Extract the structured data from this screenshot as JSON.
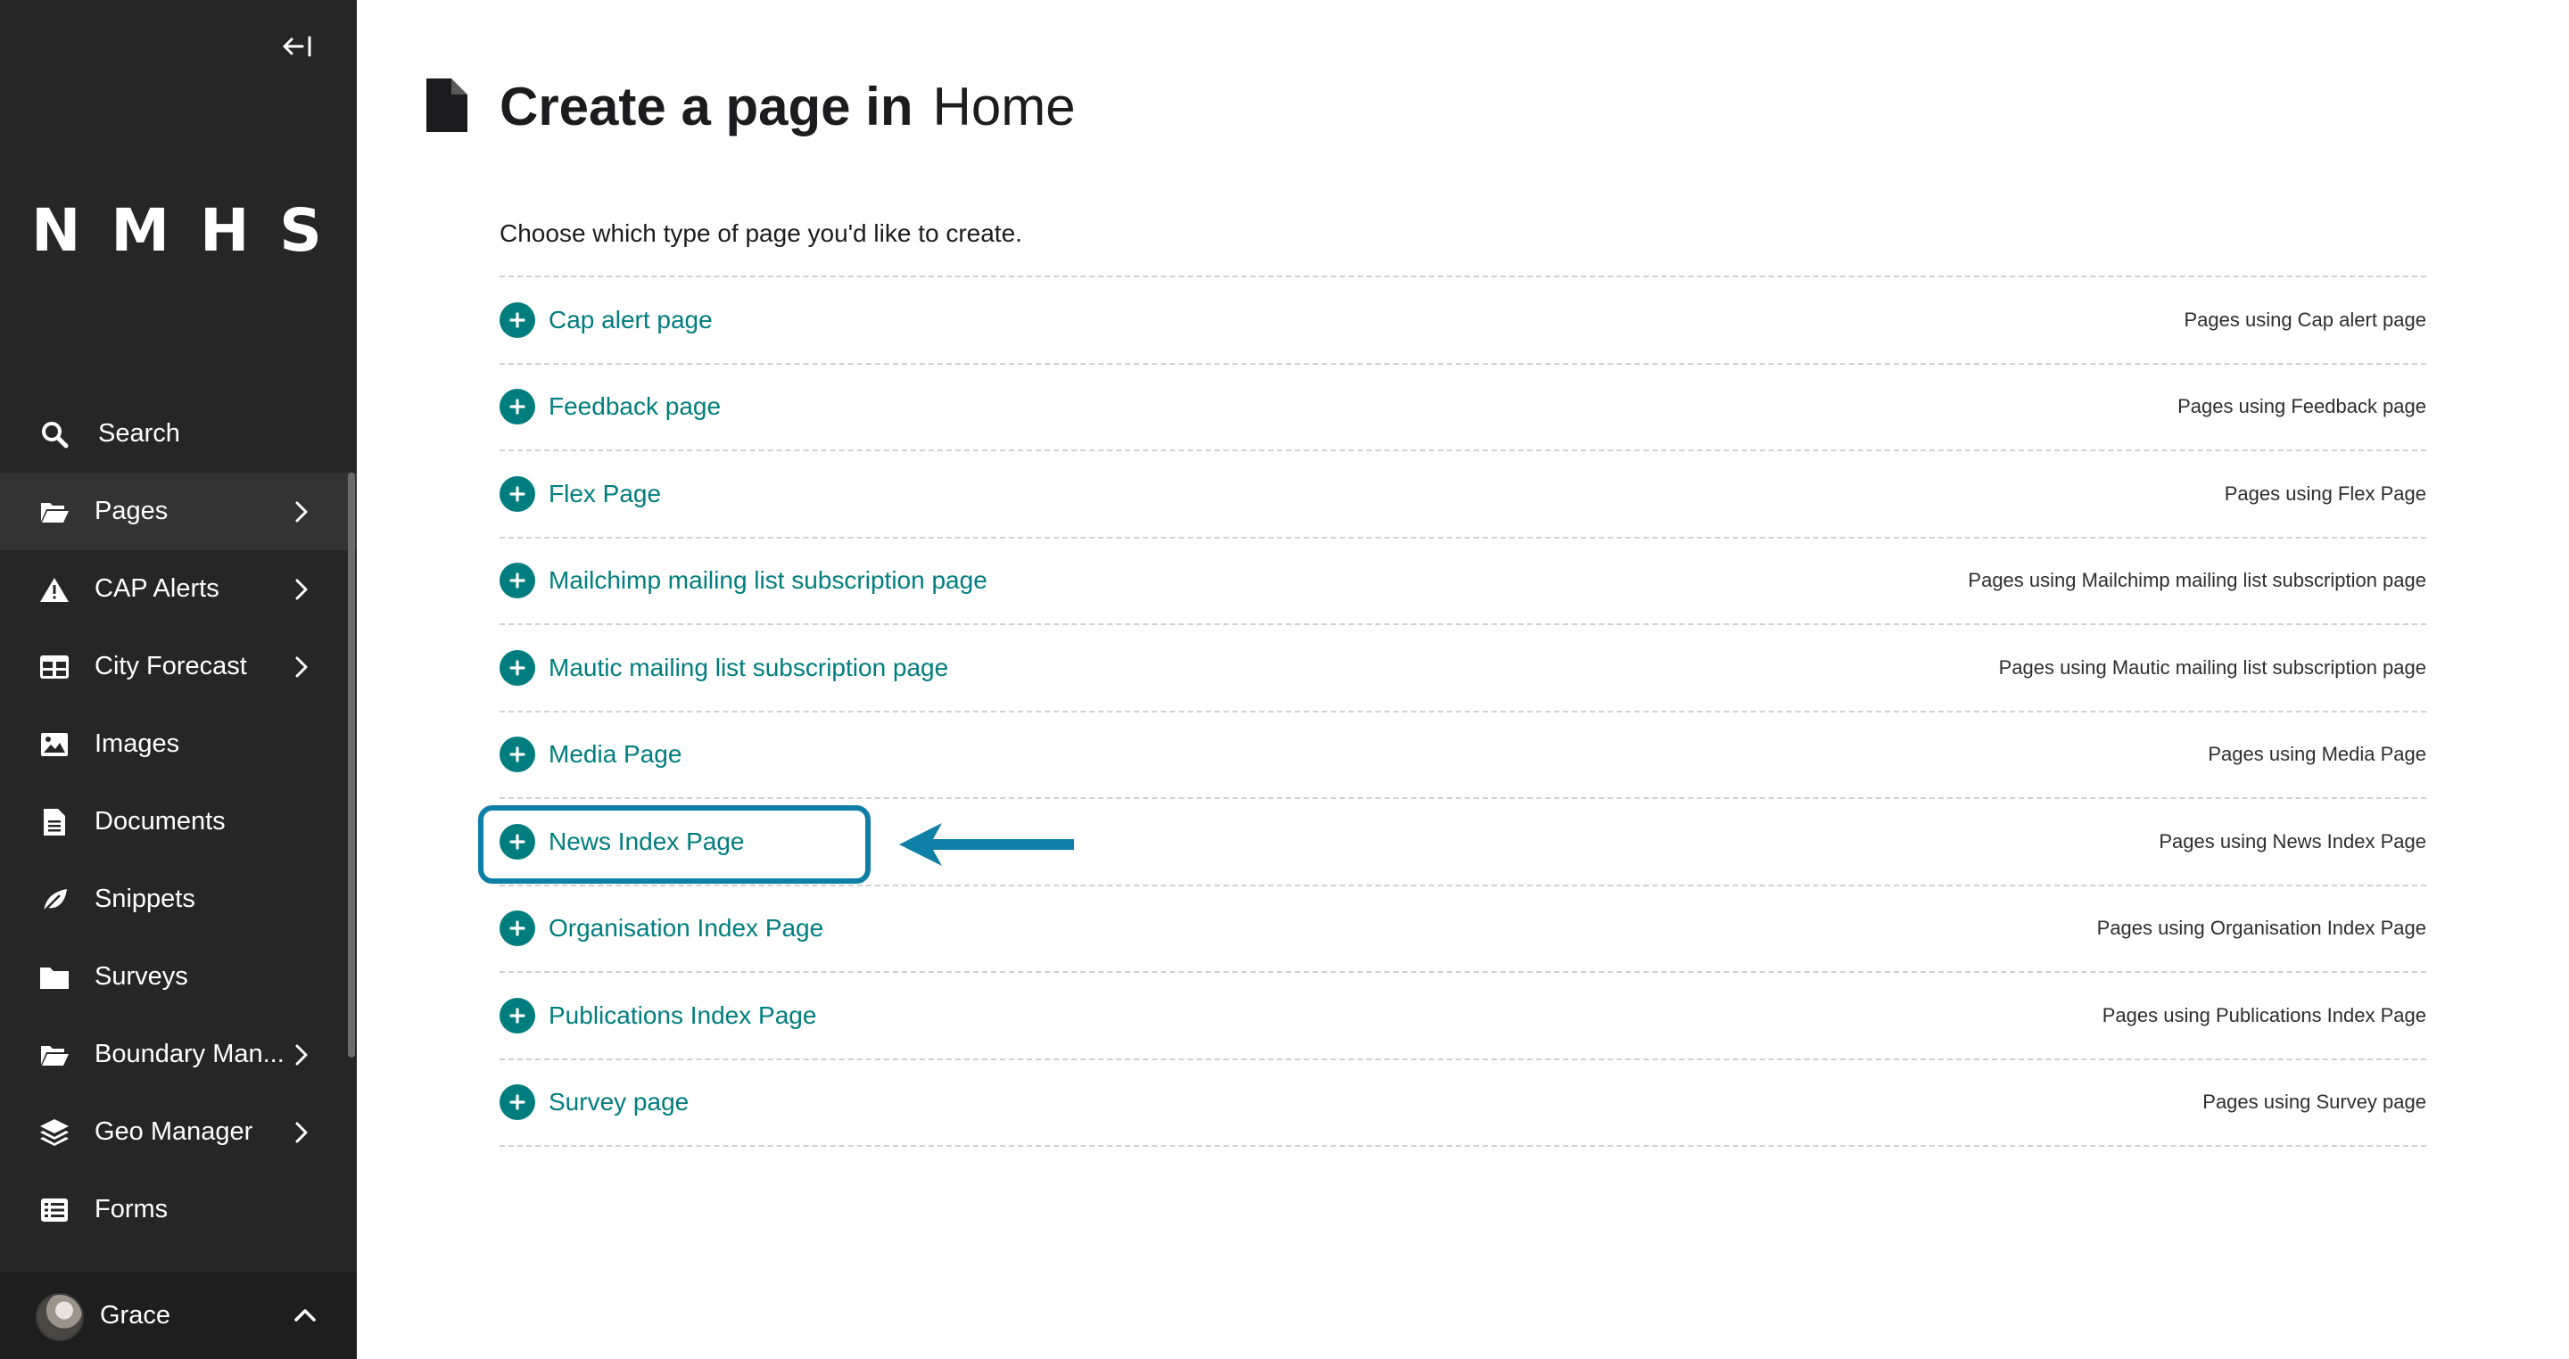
{
  "sidebar": {
    "logo": "NMHS",
    "items": [
      {
        "label": "Search",
        "icon": "search-icon",
        "has_submenu": false
      },
      {
        "label": "Pages",
        "icon": "folder-open-icon",
        "has_submenu": true,
        "active": true
      },
      {
        "label": "CAP Alerts",
        "icon": "warning-icon",
        "has_submenu": true
      },
      {
        "label": "City Forecast",
        "icon": "table-icon",
        "has_submenu": true
      },
      {
        "label": "Images",
        "icon": "image-icon",
        "has_submenu": false
      },
      {
        "label": "Documents",
        "icon": "document-icon",
        "has_submenu": false
      },
      {
        "label": "Snippets",
        "icon": "snippet-icon",
        "has_submenu": false
      },
      {
        "label": "Surveys",
        "icon": "folder-icon",
        "has_submenu": false
      },
      {
        "label": "Boundary Man...",
        "icon": "folder-open-icon",
        "has_submenu": true
      },
      {
        "label": "Geo Manager",
        "icon": "layers-icon",
        "has_submenu": true
      },
      {
        "label": "Forms",
        "icon": "list-icon",
        "has_submenu": false
      }
    ],
    "account": {
      "name": "Grace"
    }
  },
  "header": {
    "title_strong": "Create a page in",
    "title_parent": "Home"
  },
  "main": {
    "intro": "Choose which type of page you'd like to create.",
    "page_types": [
      {
        "label": "Cap alert page",
        "usage": "Pages using Cap alert page"
      },
      {
        "label": "Feedback page",
        "usage": "Pages using Feedback page"
      },
      {
        "label": "Flex Page",
        "usage": "Pages using Flex Page"
      },
      {
        "label": "Mailchimp mailing list subscription page",
        "usage": "Pages using Mailchimp mailing list subscription page"
      },
      {
        "label": "Mautic mailing list subscription page",
        "usage": "Pages using Mautic mailing list subscription page"
      },
      {
        "label": "Media Page",
        "usage": "Pages using Media Page"
      },
      {
        "label": "News Index Page",
        "usage": "Pages using News Index Page",
        "highlighted": true
      },
      {
        "label": "Organisation Index Page",
        "usage": "Pages using Organisation Index Page"
      },
      {
        "label": "Publications Index Page",
        "usage": "Pages using Publications Index Page"
      },
      {
        "label": "Survey page",
        "usage": "Pages using Survey page"
      }
    ]
  },
  "colors": {
    "sidebar_bg": "#262626",
    "accent_teal": "#007d7e",
    "annotation_blue": "#0e7fa6"
  }
}
